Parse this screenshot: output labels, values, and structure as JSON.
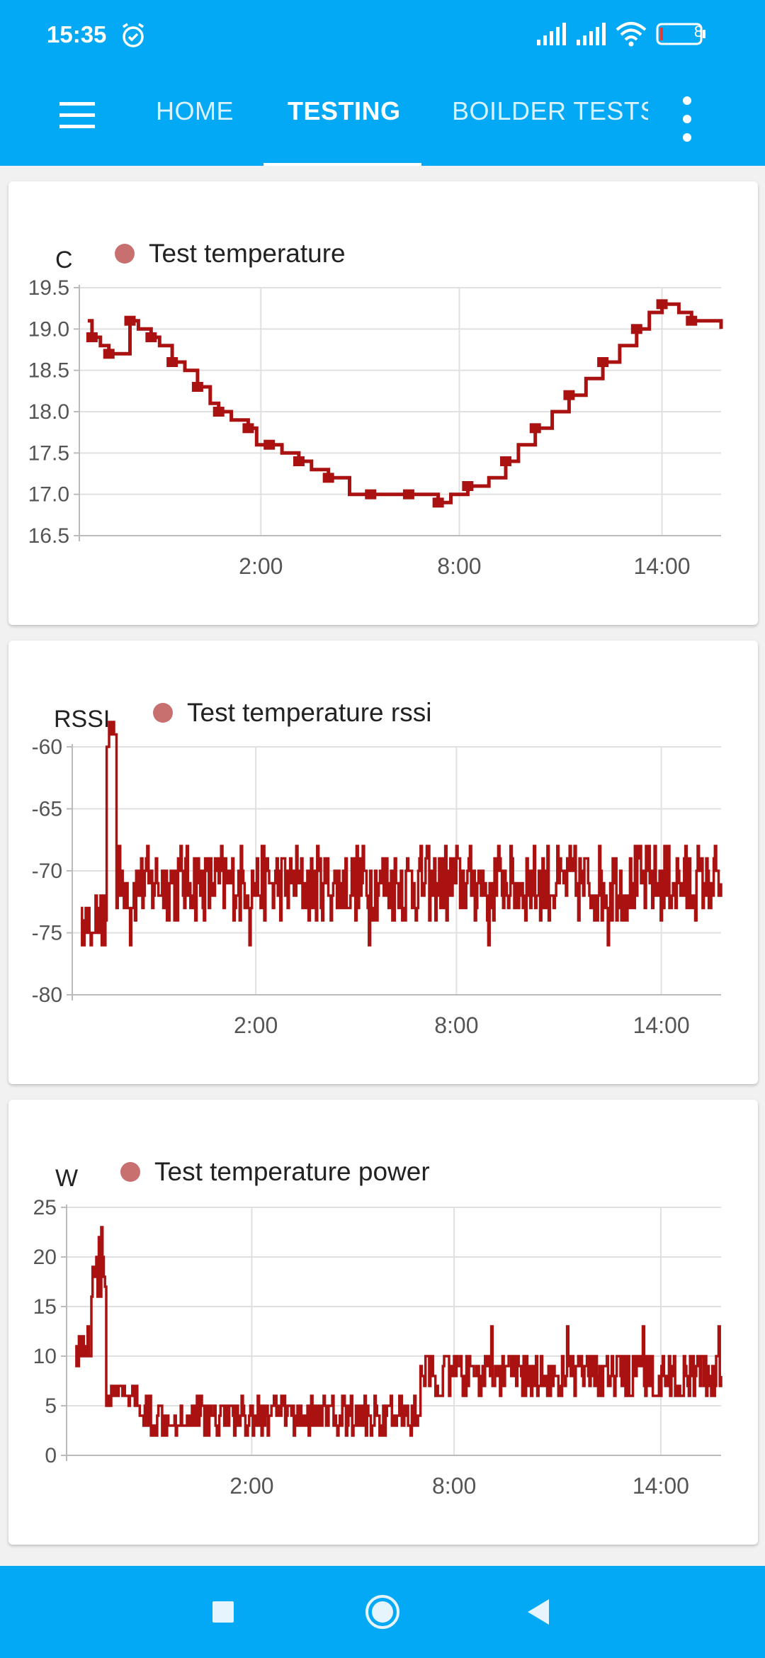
{
  "status_bar": {
    "time": "15:35",
    "battery": "8",
    "icons": [
      "alarm-icon",
      "signal-icon",
      "signal-icon",
      "wifi-icon",
      "battery-icon"
    ]
  },
  "app_bar": {
    "tabs": [
      {
        "label": "HOME",
        "active": false
      },
      {
        "label": "TESTING",
        "active": true
      },
      {
        "label": "BOILDER TESTS",
        "active": false
      }
    ],
    "accent": "#03a9f4"
  },
  "charts_meta": {
    "series_color": "#aa1111",
    "legend_color": "#c87070"
  },
  "chart_data": [
    {
      "type": "line",
      "unit": "C",
      "series": [
        {
          "name": "Test temperature",
          "x": [
            0,
            0.1,
            0.3,
            0.5,
            0.8,
            1.0,
            1.2,
            1.5,
            1.7,
            2.0,
            2.3,
            2.6,
            2.9,
            3.1,
            3.4,
            3.8,
            4.0,
            4.3,
            4.6,
            5.0,
            5.3,
            5.7,
            6.2,
            6.7,
            7.1,
            7.6,
            8.0,
            8.3,
            8.6,
            9.0,
            9.5,
            9.9,
            10.2,
            10.6,
            11.0,
            11.4,
            11.8,
            12.2,
            12.6,
            13.0,
            13.3,
            13.6,
            14.0,
            14.3,
            14.6,
            15.0
          ],
          "values": [
            19.1,
            18.9,
            18.8,
            18.7,
            18.7,
            19.1,
            19.0,
            18.9,
            18.8,
            18.6,
            18.5,
            18.3,
            18.1,
            18.0,
            17.9,
            17.8,
            17.6,
            17.6,
            17.5,
            17.4,
            17.3,
            17.2,
            17.0,
            17.0,
            17.0,
            17.0,
            17.0,
            16.9,
            17.0,
            17.1,
            17.2,
            17.4,
            17.6,
            17.8,
            18.0,
            18.2,
            18.4,
            18.6,
            18.8,
            19.0,
            19.2,
            19.3,
            19.2,
            19.1,
            19.1,
            19.0
          ]
        }
      ],
      "y_ticks": [
        "19.5",
        "19.0",
        "18.5",
        "18.0",
        "17.5",
        "17.0",
        "16.5"
      ],
      "ylim": [
        16.5,
        19.5
      ],
      "x_ticks": [
        "2:00",
        "8:00",
        "14:00"
      ],
      "x_tick_positions_hours": [
        4.1,
        8.8,
        13.6
      ],
      "xlim": [
        -0.2,
        15.0
      ]
    },
    {
      "type": "line",
      "unit": "RSSI",
      "series": [
        {
          "name": "Test temperature rssi",
          "noise": true,
          "base": -71,
          "amplitude": 3,
          "spike_value": -61,
          "min_value": -76
        }
      ],
      "y_ticks": [
        "-60",
        "-65",
        "-70",
        "-75",
        "-80"
      ],
      "ylim": [
        -80,
        -60
      ],
      "x_ticks": [
        "2:00",
        "8:00",
        "14:00"
      ],
      "x_tick_positions_hours": [
        4.1,
        8.8,
        13.6
      ],
      "xlim": [
        -0.2,
        15.0
      ]
    },
    {
      "type": "line",
      "unit": "W",
      "series": [
        {
          "name": "Test temperature power",
          "noise": true,
          "segments": [
            {
              "from": 0.0,
              "to": 0.35,
              "base": 11,
              "amplitude": 2
            },
            {
              "from": 0.35,
              "to": 0.7,
              "base": 19,
              "amplitude": 4
            },
            {
              "from": 0.7,
              "to": 1.5,
              "base": 6,
              "amplitude": 1.5
            },
            {
              "from": 1.5,
              "to": 8.0,
              "base": 4,
              "amplitude": 2
            },
            {
              "from": 8.0,
              "to": 15.0,
              "base": 8,
              "amplitude": 2.5
            }
          ]
        }
      ],
      "y_ticks": [
        "25",
        "20",
        "15",
        "10",
        "5",
        "0"
      ],
      "ylim": [
        0,
        25
      ],
      "x_ticks": [
        "2:00",
        "8:00",
        "14:00"
      ],
      "x_tick_positions_hours": [
        4.1,
        8.8,
        13.6
      ],
      "xlim": [
        -0.2,
        15.0
      ]
    }
  ]
}
